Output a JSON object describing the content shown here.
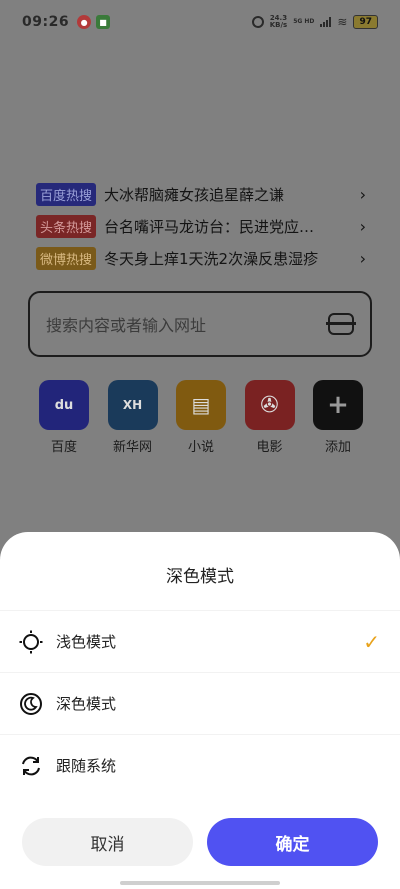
{
  "status_bar": {
    "time": "09:26",
    "net_speed_value": "24.3",
    "net_speed_unit": "KB/s",
    "network_type": "5G HD",
    "battery": "97"
  },
  "hot_search": [
    {
      "badge": "百度热搜",
      "text": "大冰帮脑瘫女孩追星薛之谦",
      "color": "#26297a"
    },
    {
      "badge": "头条热搜",
      "text": "台名嘴评马龙访台：民进党应…",
      "color": "#7a2626"
    },
    {
      "badge": "微博热搜",
      "text": "冬天身上痒1天洗2次澡反患湿疹",
      "color": "#7a5a1a"
    }
  ],
  "search": {
    "placeholder": "搜索内容或者输入网址",
    "icon": "scan-icon"
  },
  "shortcuts": [
    {
      "label": "百度",
      "icon": "baidu-icon"
    },
    {
      "label": "新华网",
      "icon": "xinhua-icon"
    },
    {
      "label": "小说",
      "icon": "book-icon"
    },
    {
      "label": "电影",
      "icon": "film-reel-icon"
    },
    {
      "label": "添加",
      "icon": "plus-icon"
    }
  ],
  "sheet": {
    "title": "深色模式",
    "options": [
      {
        "label": "浅色模式",
        "icon": "sun-icon",
        "selected": true
      },
      {
        "label": "深色模式",
        "icon": "moon-icon",
        "selected": false
      },
      {
        "label": "跟随系统",
        "icon": "sync-icon",
        "selected": false
      }
    ],
    "cancel_label": "取消",
    "confirm_label": "确定"
  },
  "colors": {
    "accent": "#5052f2",
    "check": "#e8a21a"
  }
}
